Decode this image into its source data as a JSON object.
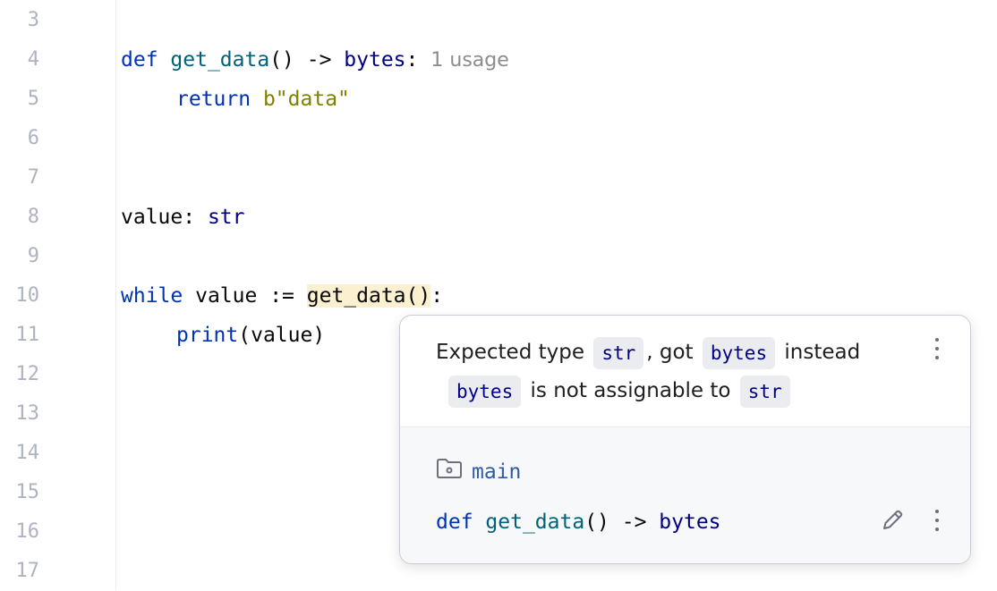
{
  "gutter": {
    "line_numbers": [
      "3",
      "4",
      "5",
      "6",
      "7",
      "8",
      "9",
      "10",
      "11",
      "12",
      "13",
      "14",
      "15",
      "16",
      "17"
    ]
  },
  "code": {
    "l4_def": "def",
    "l4_name": "get_data",
    "l4_params": "() ->",
    "l4_type": "bytes",
    "l4_colon": ":",
    "l4_hint": "1 usage",
    "l5_return": "return",
    "l5_value": "b\"data\"",
    "l8_var": "value:",
    "l8_type": "str",
    "l10_while": "while",
    "l10_mid": "value :=",
    "l10_call": "get_data()",
    "l10_colon": ":",
    "l11_print": "print",
    "l11_args": "(value)"
  },
  "popup": {
    "msg1_a": "Expected type",
    "msg1_chip1": "str",
    "msg1_b": ", got",
    "msg1_chip2": "bytes",
    "msg1_c": "instead",
    "msg2_chip1": "bytes",
    "msg2_b": "is not assignable to",
    "msg2_chip2": "str",
    "module_name": "main",
    "sig_def": "def",
    "sig_name": "get_data",
    "sig_params": "() ->",
    "sig_type": "bytes",
    "icons": [
      "folder-icon",
      "pencil-icon",
      "more-vertical-icon"
    ]
  }
}
